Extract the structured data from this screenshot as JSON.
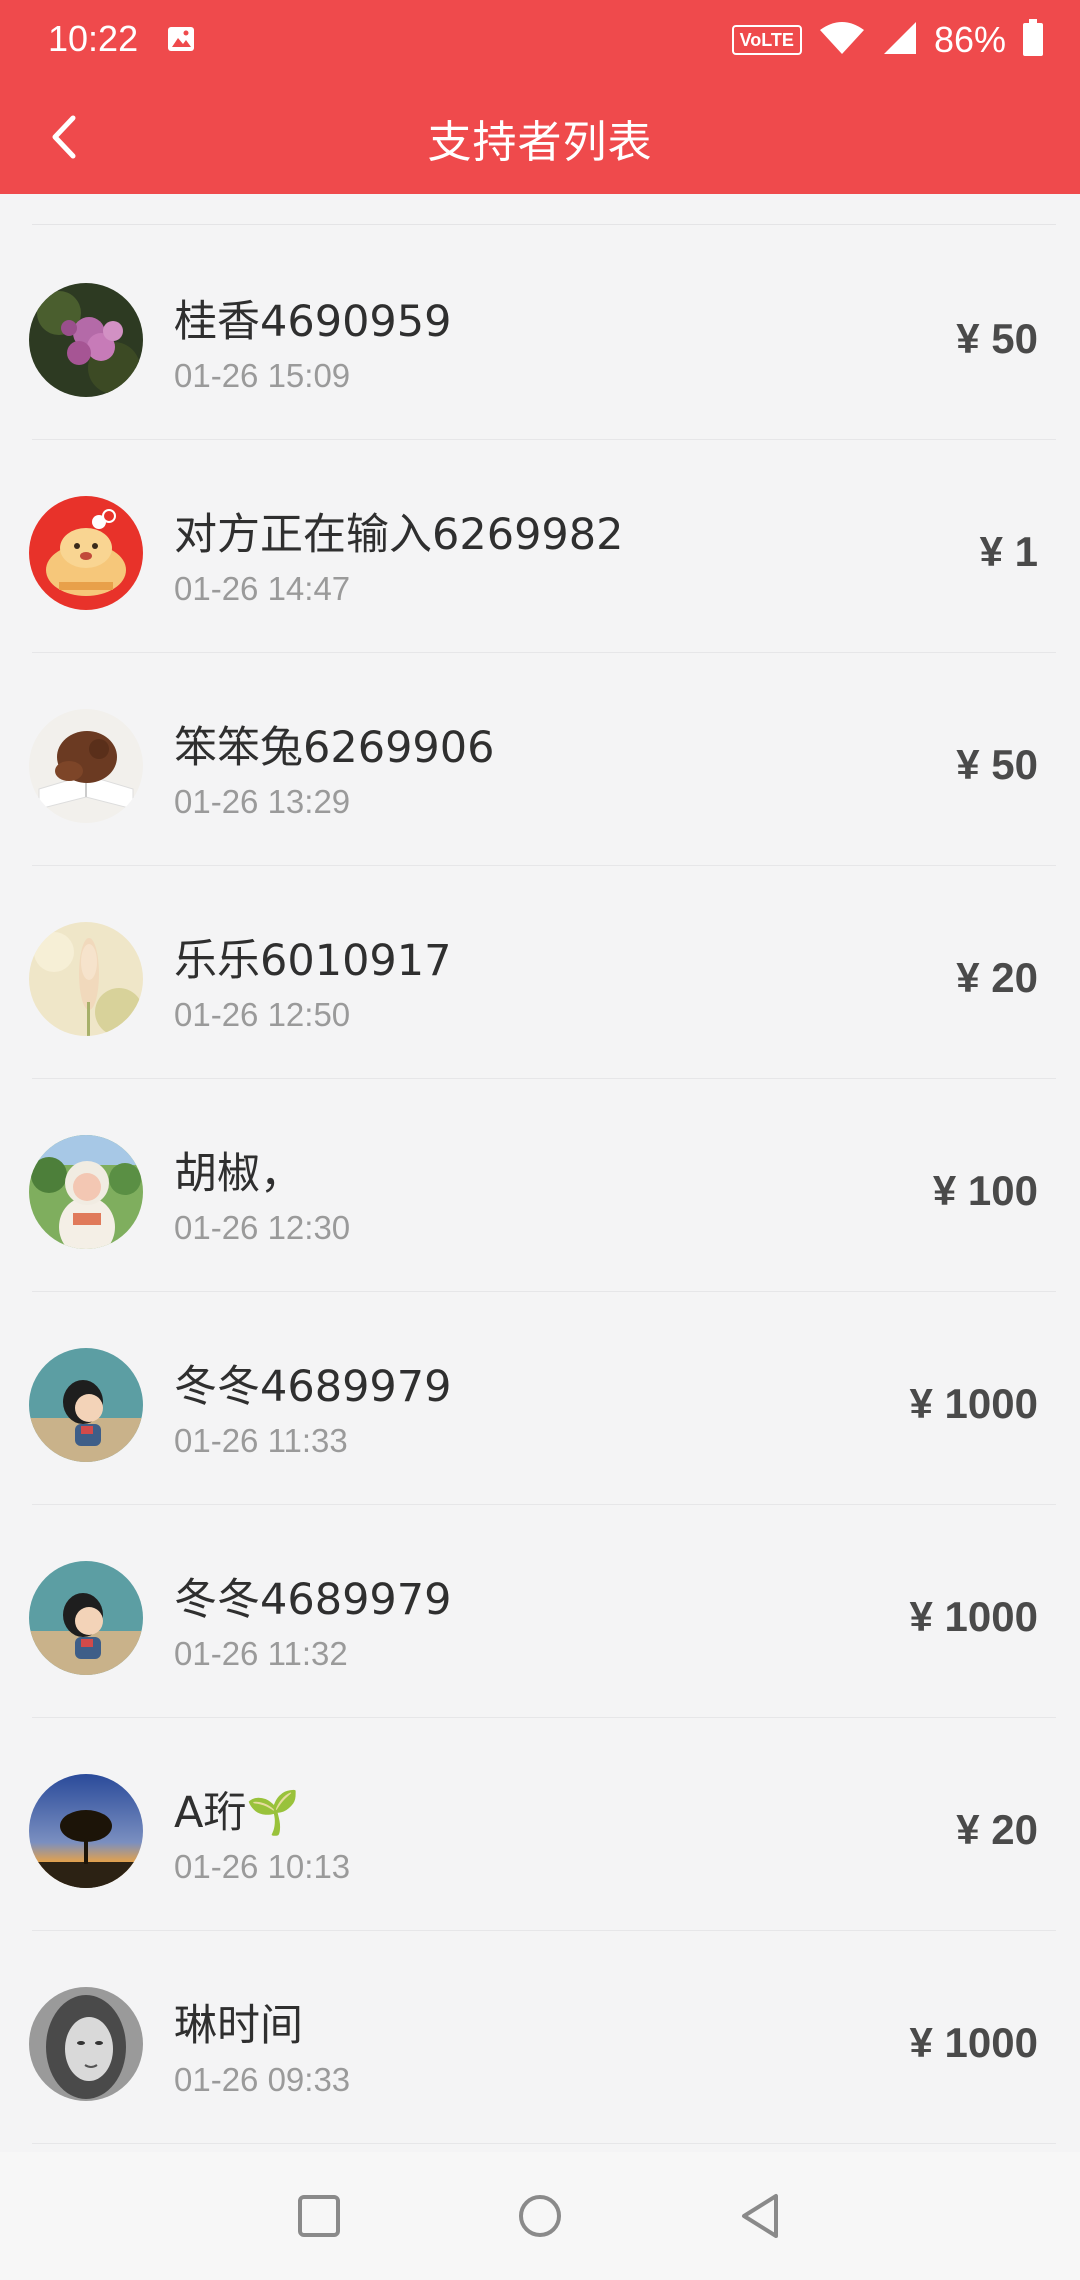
{
  "status": {
    "time": "10:22",
    "volte": "VoLTE",
    "battery": "86%"
  },
  "appbar": {
    "title": "支持者列表"
  },
  "supporters": [
    {
      "name": "桂香4690959",
      "time": "01-26 15:09",
      "amount": "¥ 50",
      "avatar": "flower-photo"
    },
    {
      "name": "对方正在输入6269982",
      "time": "01-26 14:47",
      "amount": "¥ 1",
      "avatar": "cartoon-bear"
    },
    {
      "name": "笨笨兔6269906",
      "time": "01-26 13:29",
      "amount": "¥ 50",
      "avatar": "book-photo"
    },
    {
      "name": "乐乐6010917",
      "time": "01-26 12:50",
      "amount": "¥ 20",
      "avatar": "lupine-photo"
    },
    {
      "name": "胡椒，",
      "time": "01-26 12:30",
      "amount": "¥ 100",
      "avatar": "girl-photo"
    },
    {
      "name": "冬冬4689979",
      "time": "01-26 11:33",
      "amount": "¥ 1000",
      "avatar": "cartoon-girl"
    },
    {
      "name": "冬冬4689979",
      "time": "01-26 11:32",
      "amount": "¥ 1000",
      "avatar": "cartoon-girl"
    },
    {
      "name": "A珩🌱",
      "time": "01-26 10:13",
      "amount": "¥ 20",
      "avatar": "sunset-tree"
    },
    {
      "name": "琳时间",
      "time": "01-26 09:33",
      "amount": "¥ 1000",
      "avatar": "sketch-portrait"
    }
  ],
  "colors": {
    "accent": "#ef4a4c",
    "background": "#f4f4f5",
    "amount": "#4a4a4a",
    "time": "#9a9a9a"
  }
}
